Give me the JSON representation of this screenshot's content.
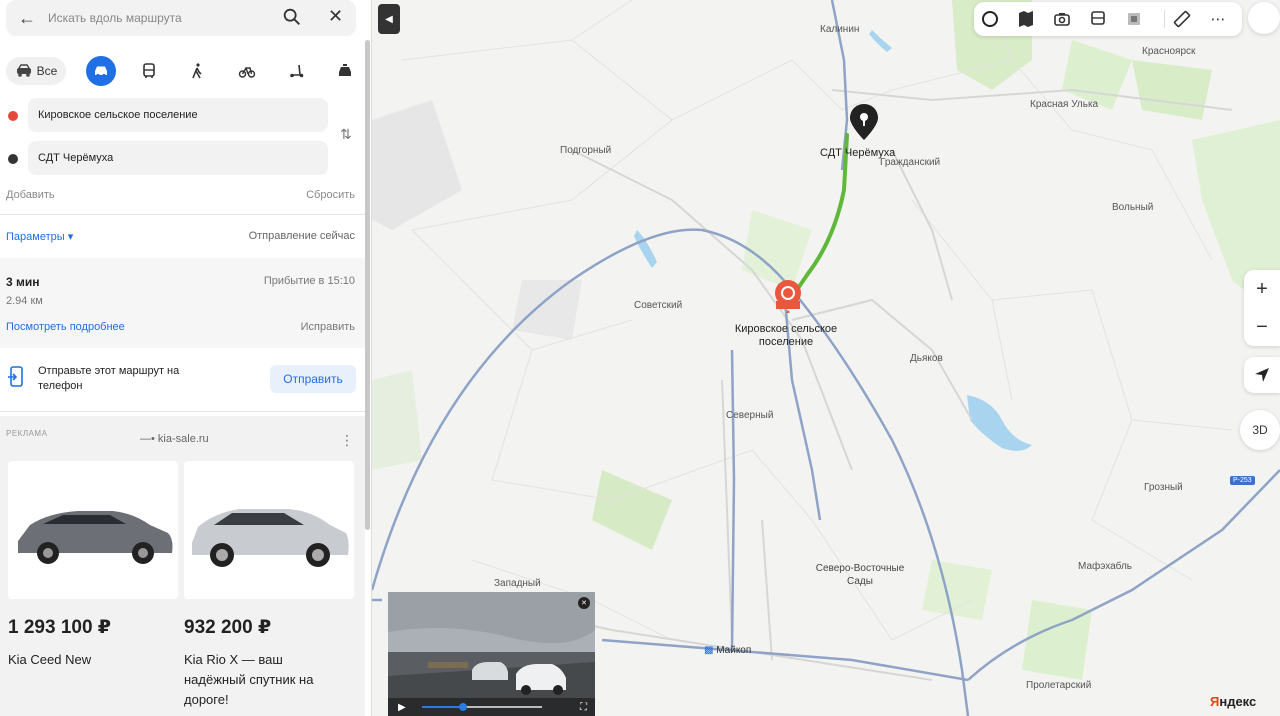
{
  "search": {
    "placeholder": "Искать вдоль маршрута"
  },
  "modes": {
    "all_label": "Все",
    "active": "car"
  },
  "route": {
    "from": "Кировское сельское поселение",
    "to": "СДТ Черёмуха",
    "add_label": "Добавить",
    "reset_label": "Сбросить"
  },
  "params": {
    "label": "Параметры ▾",
    "departure": "Отправление сейчас"
  },
  "summary": {
    "time": "3 мин",
    "distance": "2.94 км",
    "arrival": "Прибытие в 15:10",
    "details_link": "Посмотреть подробнее",
    "fix_link": "Исправить"
  },
  "send": {
    "text": "Отправьте этот маршрут на телефон",
    "button": "Отправить"
  },
  "ad": {
    "label": "РЕКЛАМА",
    "site": "kia-sale.ru",
    "items": [
      {
        "price": "1 293 100 ₽",
        "name": "Kia Ceed New"
      },
      {
        "price": "932 200 ₽",
        "name": "Kia Rio X — ваш надёжный спутник на дороге!"
      }
    ]
  },
  "map": {
    "labels": {
      "kalinin": "Калинин",
      "krasnoyarsk": "Красноярск",
      "krasnaya_ulka": "Красная Улька",
      "podgorny": "Подгорный",
      "cheremukha": "СДТ Черёмуха",
      "grazhdansky": "Гражданский",
      "volny": "Вольный",
      "sovetsky": "Советский",
      "kirovskoe": "Кировское сельское поселение",
      "dyakov": "Дьяков",
      "severny": "Северный",
      "grozny": "Грозный",
      "zapadny": "Западный",
      "severo_vostochnye": "Северо-Восточные Сады",
      "maykop": "Майкоп",
      "mafekhabl": "Мафэхабль",
      "proletarsky": "Пролетарский",
      "road_badge": "Р-253"
    },
    "btn_3d": "3D",
    "brand": "Яндекс"
  },
  "video": {
    "progress": 0.34
  },
  "colors": {
    "accent": "#1f6fe5",
    "route": "#5fb83a",
    "poi": "#e8573e"
  }
}
